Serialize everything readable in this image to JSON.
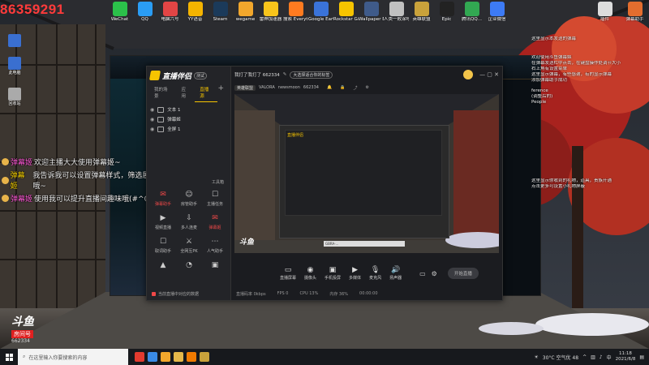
{
  "overlay": {
    "room_id": "86359291"
  },
  "desktop_icons": [
    {
      "label": "WeChat",
      "color": "#2bc14a"
    },
    {
      "label": "QQ",
      "color": "#2a9df4"
    },
    {
      "label": "电脑六号",
      "color": "#e24545"
    },
    {
      "label": "YY语音",
      "color": "#f5b400"
    },
    {
      "label": "Steam",
      "color": "#1b3a5a"
    },
    {
      "label": "wegame",
      "color": "#f2a72c"
    },
    {
      "label": "雷神加速器",
      "color": "#f7c41b"
    },
    {
      "label": "搜索 Everything",
      "color": "#ff7b20"
    },
    {
      "label": "Google Earth Pro",
      "color": "#3a73d9"
    },
    {
      "label": "Rockstar Games...",
      "color": "#f6c400"
    },
    {
      "label": "Wallpaper Engine...",
      "color": "#3f5b8a"
    },
    {
      "label": "人类一败涂地 Human Fa...",
      "color": "#c0c0c0"
    },
    {
      "label": "英雄联盟",
      "color": "#c9a23b"
    },
    {
      "label": "Epic",
      "color": "#222222"
    },
    {
      "label": "腾讯QQ...",
      "color": "#32a852"
    },
    {
      "label": "企业微信",
      "color": "#3d7bf5"
    }
  ],
  "desktop_right_icons": [
    {
      "label": "插件",
      "color": "#ddd"
    },
    {
      "label": "弹幕助手",
      "color": "#e36d2e"
    }
  ],
  "left_icons": [
    {
      "label": "",
      "color": "#3a6fd0"
    },
    {
      "label": "此电脑",
      "color": "#3a6fd0"
    },
    {
      "label": "回收站",
      "color": "#aaa"
    }
  ],
  "chat": [
    {
      "name": "弹幕姬",
      "text": "欢迎主播大大使用弹幕姬~"
    },
    {
      "name": "弹幕姬",
      "text": "我告诉我可以设置弹幕样式，筛选展示哦~"
    },
    {
      "name": "弹幕姬",
      "text": "使用我可以提升直播间趣味哦(#^0^#)"
    }
  ],
  "right_text": [
    "这里显示本发送的弹幕",
    "欢迎使用斗鱼弹幕姬",
    "在弹幕发送栏中点击，在键盘操作处调节大小",
    "右上角有设置菜单",
    "这里显示弹幕，有些感谢，有的显示弹幕",
    "添加弹幕助手成功",
    "ference",
    "(调整后的)",
    "People",
    "这里显示你收到的礼物，道具，贵族开通",
    "点击更多可设置小礼物屏蔽"
  ],
  "app": {
    "logo_text": "直播伴侣",
    "logo_badge": "测试",
    "tabs": [
      "我的场景",
      "应用",
      "直播源"
    ],
    "active_tab": 2,
    "scenes": [
      {
        "name": "文本 1"
      },
      {
        "name": "弹幕姬"
      },
      {
        "name": "全屏 1"
      }
    ],
    "tools_label": "工具箱",
    "tools": [
      {
        "label": "弹幕助手",
        "icon": "✉",
        "red": true
      },
      {
        "label": "房管助手",
        "icon": "☺",
        "red": false
      },
      {
        "label": "主播任务",
        "icon": "☐",
        "red": false
      },
      {
        "label": "视频直播",
        "icon": "▶",
        "red": false
      },
      {
        "label": "多人连麦",
        "icon": "⇩",
        "red": false
      },
      {
        "label": "弹幕姬",
        "icon": "✉",
        "red": true
      },
      {
        "label": "取词助手",
        "icon": "☐",
        "red": false
      },
      {
        "label": "全网互PK",
        "icon": "⚔",
        "red": false
      },
      {
        "label": "人气助手",
        "icon": "⋯",
        "red": false
      },
      {
        "label": "",
        "icon": "▲",
        "red": false
      },
      {
        "label": "",
        "icon": "◔",
        "red": false
      },
      {
        "label": "",
        "icon": "▣",
        "red": false
      }
    ],
    "left_bottom": "当前直播中对应的数据",
    "header": {
      "title": "我打了我打了 662334",
      "chip": "大选择适合你的标签",
      "tag": "英雄联盟",
      "game": "VALORA",
      "user": "newsmoon",
      "id_num": "662334"
    },
    "preview_app_logo": "直播伴侣",
    "watermark_logo": "斗鱼",
    "url_text": "GBRA-...",
    "controls": [
      {
        "label": "直播屏幕",
        "icon": "▭"
      },
      {
        "label": "摄像头",
        "icon": "◉"
      },
      {
        "label": "手机投屏",
        "icon": "▣"
      },
      {
        "label": "多媒体",
        "icon": "▶"
      },
      {
        "label": "麦克风",
        "icon": "🎙"
      },
      {
        "label": "扬声器",
        "icon": "🔊"
      }
    ],
    "start_button": "开始直播",
    "status": [
      "直播码率 0kbps",
      "FPS 0",
      "CPU 13%",
      "内存 36%",
      "00:00:00"
    ]
  },
  "watermark": {
    "logo": "斗鱼",
    "room_label": "房间号",
    "room_num": "662334"
  },
  "taskbar": {
    "search_placeholder": "在这里输入你要搜索的内容",
    "weather": "30°C 空气优 48",
    "time": "11:18",
    "date": "2021/6/8"
  }
}
